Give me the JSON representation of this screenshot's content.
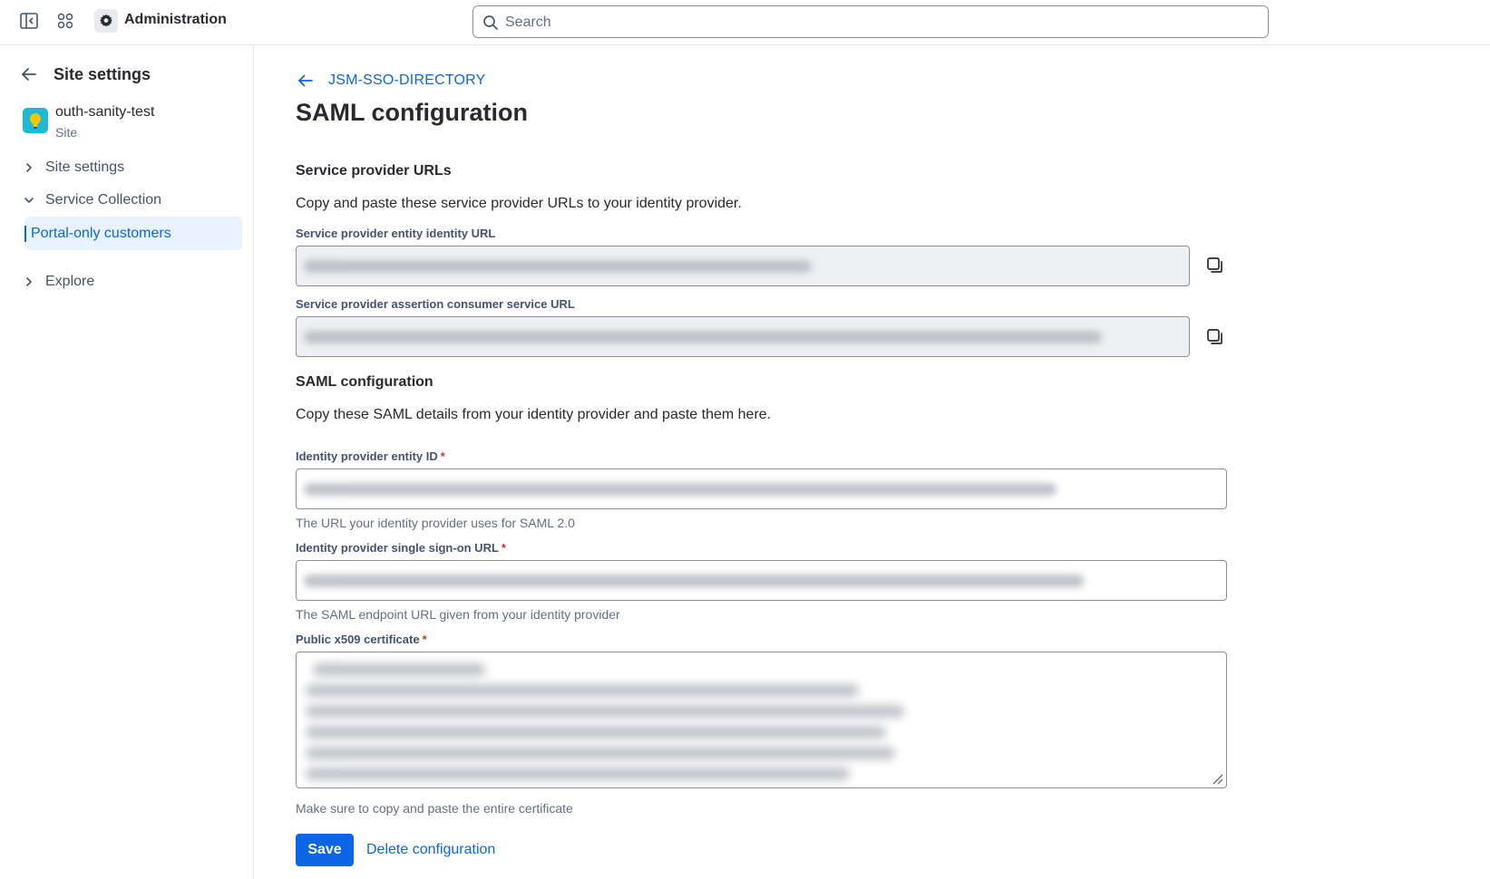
{
  "topbar": {
    "title": "Administration",
    "search_placeholder": "Search"
  },
  "sidebar": {
    "title": "Site settings",
    "site": {
      "name": "outh-sanity-test",
      "type": "Site"
    },
    "items": [
      {
        "label": "Site settings",
        "expanded": false
      },
      {
        "label": "Service Collection",
        "expanded": true
      },
      {
        "label": "Portal-only customers",
        "active": true
      },
      {
        "label": "Explore",
        "expanded": false
      }
    ]
  },
  "main": {
    "breadcrumb": "JSM-SSO-DIRECTORY",
    "title": "SAML configuration",
    "sp_section": {
      "title": "Service provider URLs",
      "description": "Copy and paste these service provider URLs to your identity provider.",
      "entity_label": "Service provider entity identity URL",
      "acs_label": "Service provider assertion consumer service URL"
    },
    "saml_section": {
      "title": "SAML configuration",
      "description": "Copy these SAML details from your identity provider and paste them here.",
      "idp_entity_label": "Identity provider entity ID",
      "idp_entity_helper": "The URL your identity provider uses for SAML 2.0",
      "idp_sso_label": "Identity provider single sign-on URL",
      "idp_sso_helper": "The SAML endpoint URL given from your identity provider",
      "cert_label": "Public x509 certificate",
      "cert_helper": "Make sure to copy and paste the entire certificate",
      "required_mark": "*"
    },
    "actions": {
      "save_label": "Save",
      "delete_label": "Delete configuration"
    }
  },
  "colors": {
    "accent": "#0c66e4",
    "active_bg": "#e9f2ff",
    "required": "#c9372c"
  }
}
